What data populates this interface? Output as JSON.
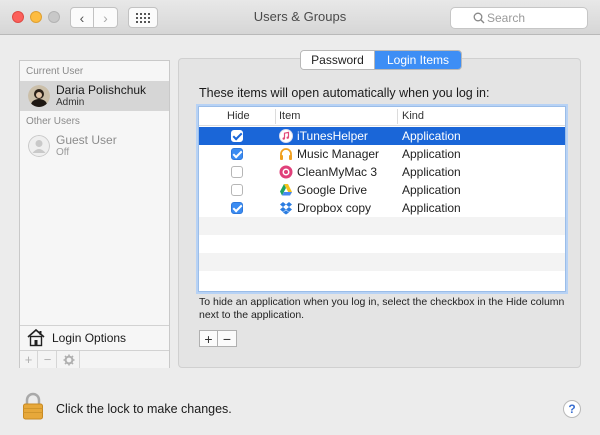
{
  "window": {
    "title": "Users & Groups",
    "search_placeholder": "Search"
  },
  "sidebar": {
    "current_user_label": "Current User",
    "current_user": {
      "name": "Daria Polishchuk",
      "role": "Admin"
    },
    "other_users_label": "Other Users",
    "guest_user": {
      "name": "Guest User",
      "status": "Off"
    },
    "login_options_label": "Login Options",
    "tools": {
      "add": "+",
      "remove": "−",
      "gear_icon": "gear-icon"
    }
  },
  "tabs": [
    {
      "label": "Password",
      "active": false
    },
    {
      "label": "Login Items",
      "active": true
    }
  ],
  "login_items": {
    "intro": "These items will open automatically when you log in:",
    "columns": {
      "hide": "Hide",
      "item": "Item",
      "kind": "Kind"
    },
    "rows": [
      {
        "hide": true,
        "name": "iTunesHelper",
        "kind": "Application",
        "icon": "itunes-icon",
        "selected": true
      },
      {
        "hide": true,
        "name": "Music Manager",
        "kind": "Application",
        "icon": "headphones-icon",
        "selected": false
      },
      {
        "hide": false,
        "name": "CleanMyMac 3",
        "kind": "Application",
        "icon": "cleanmymac-icon",
        "selected": false
      },
      {
        "hide": false,
        "name": "Google Drive",
        "kind": "Application",
        "icon": "google-drive-icon",
        "selected": false
      },
      {
        "hide": true,
        "name": "Dropbox copy",
        "kind": "Application",
        "icon": "dropbox-icon",
        "selected": false
      }
    ],
    "hint": "To hide an application when you log in, select the checkbox in the Hide column next to the application.",
    "add_label": "+",
    "remove_label": "−"
  },
  "footer": {
    "lock_text": "Click the lock to make changes.",
    "help_label": "?"
  },
  "colors": {
    "accent": "#3d8ef5",
    "selection": "#1a66d8",
    "close": "#fc605b",
    "minimize": "#fdbc40"
  }
}
